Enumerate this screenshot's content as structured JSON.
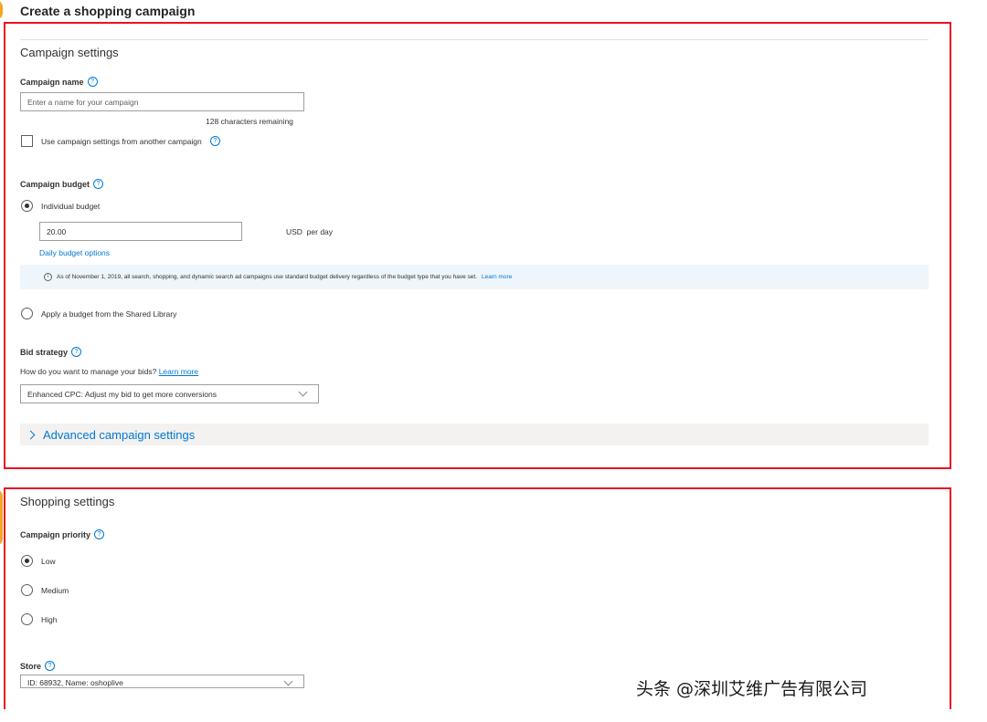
{
  "page": {
    "title": "Create a shopping campaign"
  },
  "campaign_settings": {
    "section_title": "Campaign settings",
    "name": {
      "label": "Campaign name",
      "placeholder": "Enter a name for your campaign",
      "chars_remaining": "128 characters remaining"
    },
    "copy_settings_label": "Use campaign settings from another campaign",
    "copy_settings_checked": false,
    "budget": {
      "label": "Campaign budget",
      "individual_label": "Individual budget",
      "individual_selected": true,
      "amount": "20.00",
      "unit": "USD  per day",
      "options_link": "Daily budget options",
      "info_text": "As of November 1, 2019, all search, shopping, and dynamic search ad campaigns use standard budget delivery regardless of the budget type that you have set.",
      "info_link": "Learn more",
      "shared_label": "Apply a budget from the Shared Library",
      "shared_selected": false
    },
    "bid_strategy": {
      "label": "Bid strategy",
      "question": "How do you want to manage your bids?",
      "learn_more": "Learn more",
      "selected": "Enhanced CPC: Adjust my bid to get more conversions"
    },
    "advanced_label": "Advanced campaign settings"
  },
  "shopping_settings": {
    "section_title": "Shopping settings",
    "priority": {
      "label": "Campaign priority",
      "options": [
        {
          "label": "Low",
          "selected": true
        },
        {
          "label": "Medium",
          "selected": false
        },
        {
          "label": "High",
          "selected": false
        }
      ]
    },
    "store": {
      "label": "Store",
      "selected": "ID: 68932, Name: oshoplive"
    }
  },
  "watermark": "头条 @深圳艾维广告有限公司",
  "colors": {
    "highlight_border": "#e81123",
    "accent": "#0078d4",
    "info_background": "#eef5fb",
    "marker": "#f5a623"
  },
  "icons": {
    "help": "question-circle-icon",
    "info": "info-circle-icon",
    "expand": "chevron-right-icon",
    "dropdown": "chevron-down-icon"
  }
}
